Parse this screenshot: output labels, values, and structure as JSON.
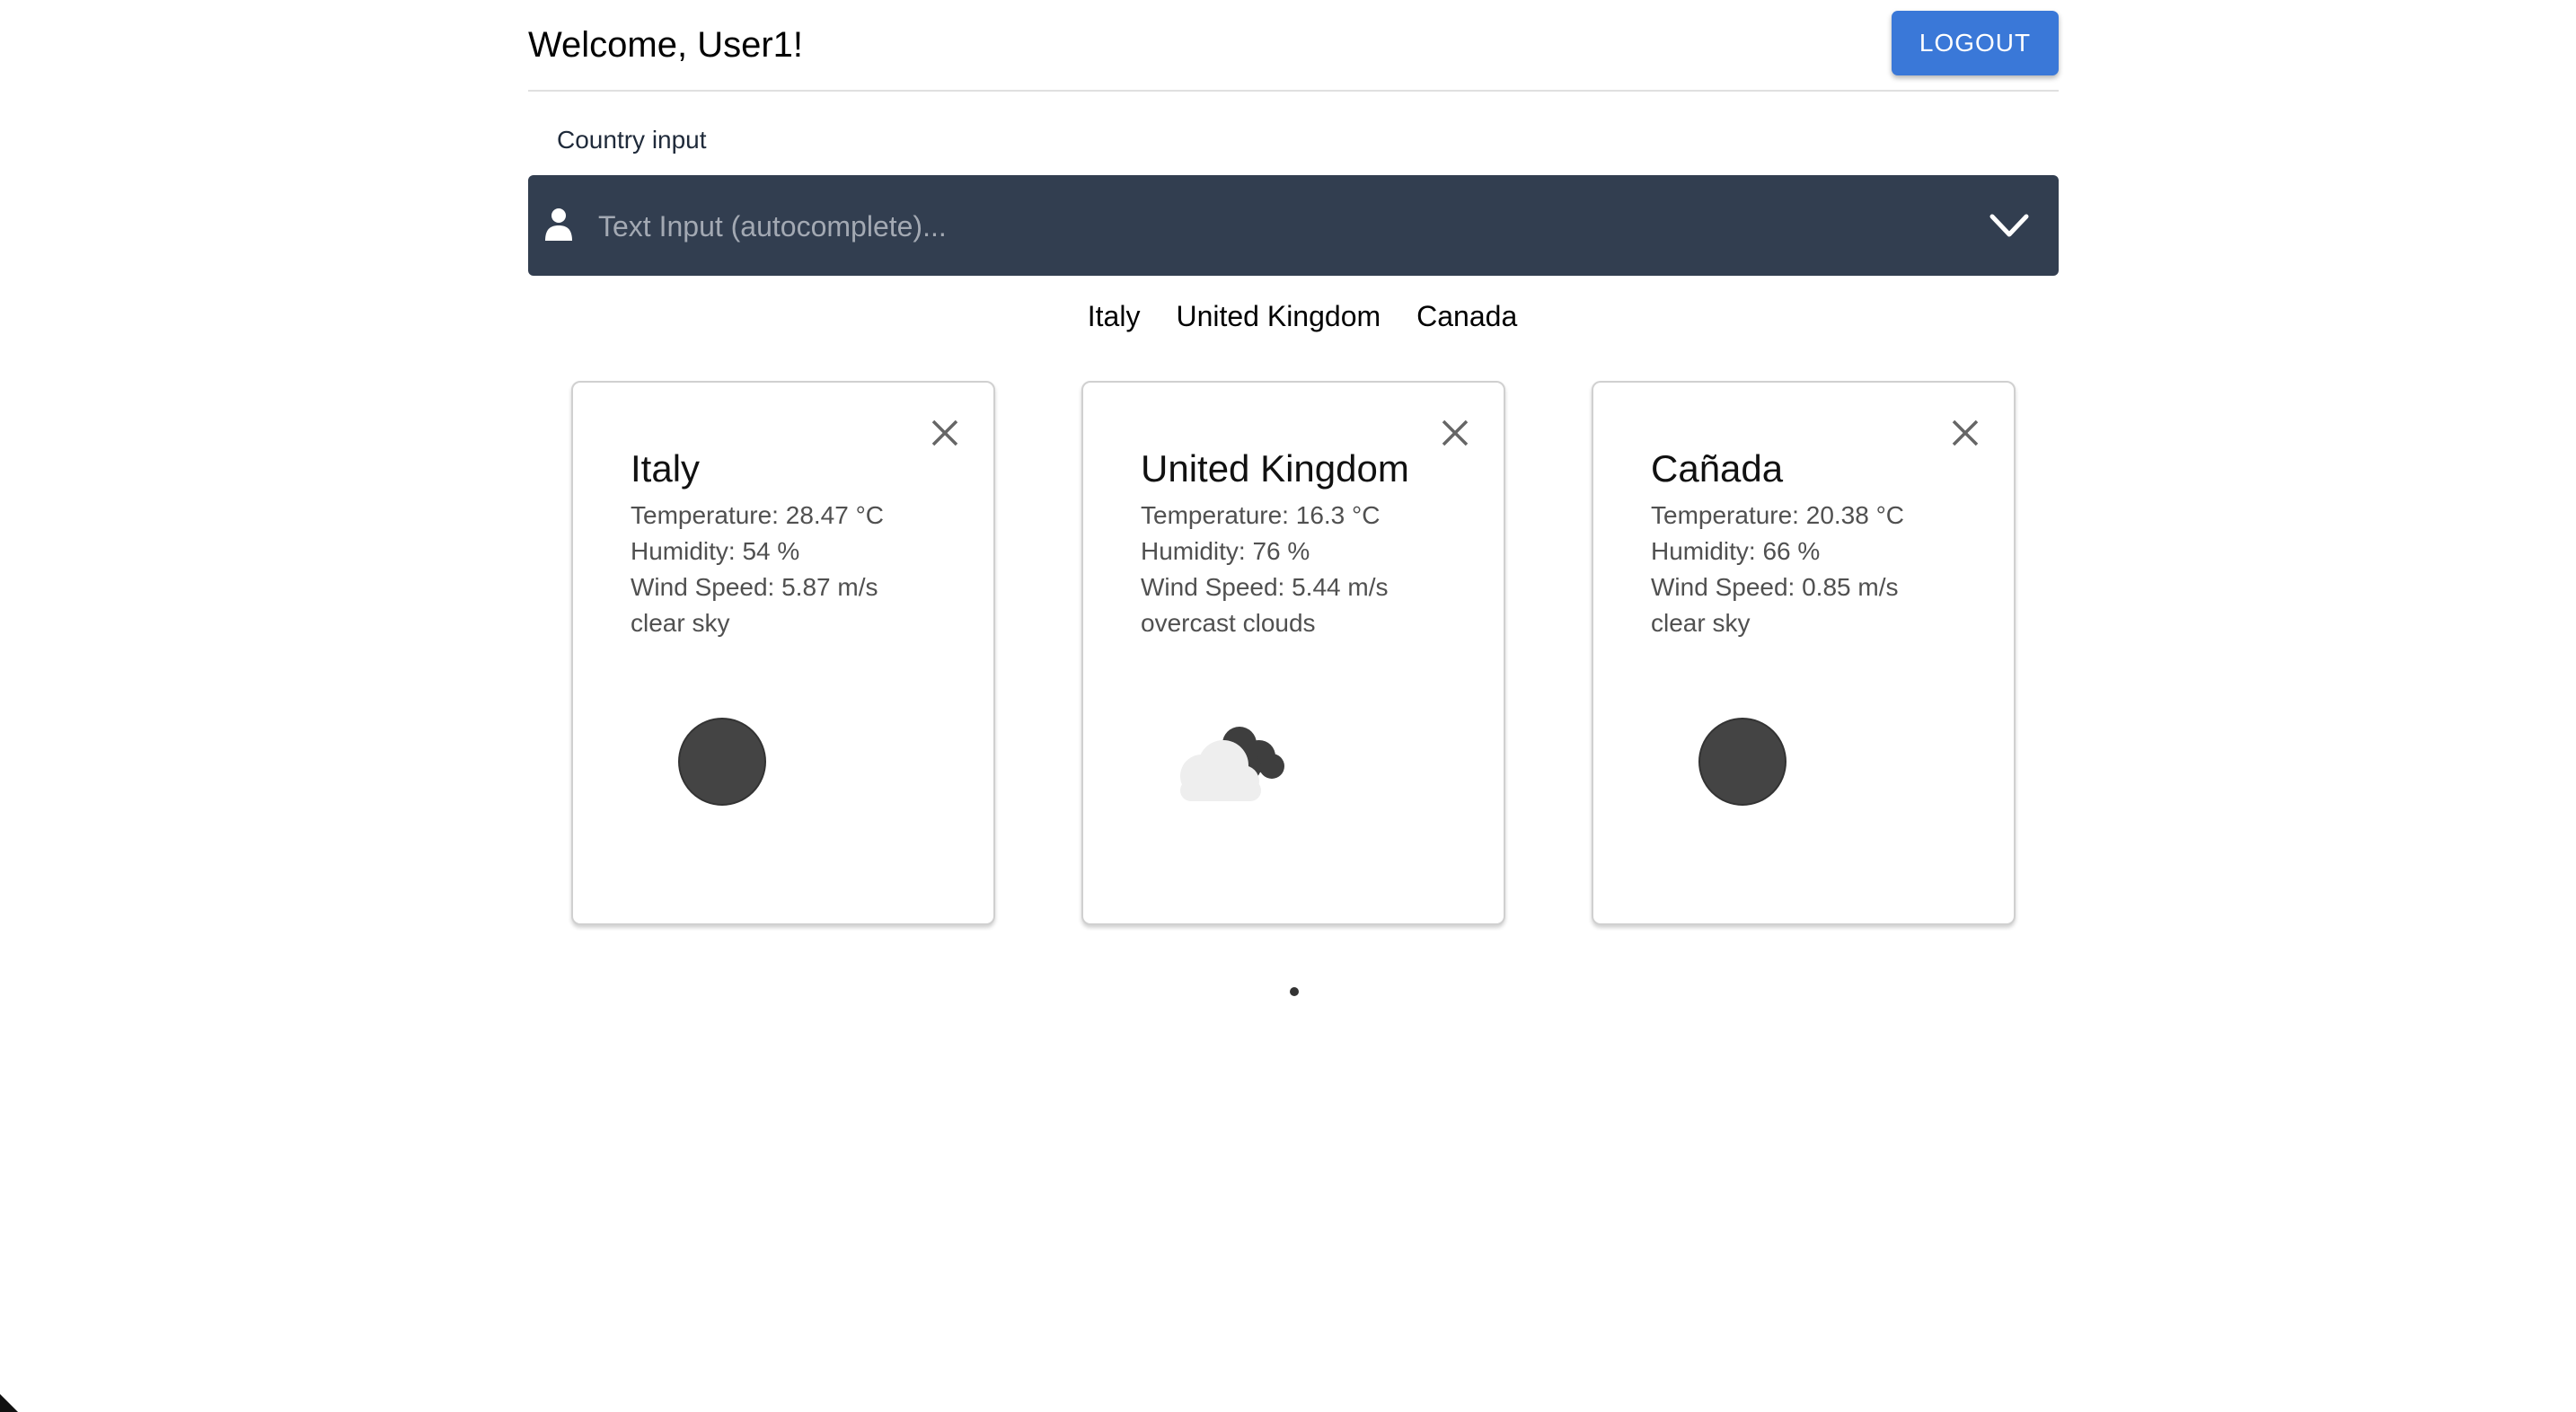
{
  "header": {
    "welcome": "Welcome, User1!",
    "logout_label": "LOGOUT"
  },
  "country_input": {
    "label": "Country input",
    "placeholder": "Text Input (autocomplete)...",
    "value": ""
  },
  "chips": [
    "Italy",
    "United Kingdom",
    "Canada"
  ],
  "cards": [
    {
      "name": "Italy",
      "temperature": "Temperature: 28.47 °C",
      "humidity": "Humidity: 54 %",
      "wind": "Wind Speed: 5.87 m/s",
      "description": "clear sky",
      "icon": "clear-sky-icon"
    },
    {
      "name": "United Kingdom",
      "temperature": "Temperature: 16.3 °C",
      "humidity": "Humidity: 76 %",
      "wind": "Wind Speed: 5.44 m/s",
      "description": "overcast clouds",
      "icon": "overcast-clouds-icon"
    },
    {
      "name": "Cañada",
      "temperature": "Temperature: 20.38 °C",
      "humidity": "Humidity: 66 %",
      "wind": "Wind Speed: 0.85 m/s",
      "description": "clear sky",
      "icon": "clear-sky-icon"
    }
  ],
  "colors": {
    "accent": "#3a78d8",
    "input_bg": "#323e50",
    "icon_dark": "#444444"
  }
}
